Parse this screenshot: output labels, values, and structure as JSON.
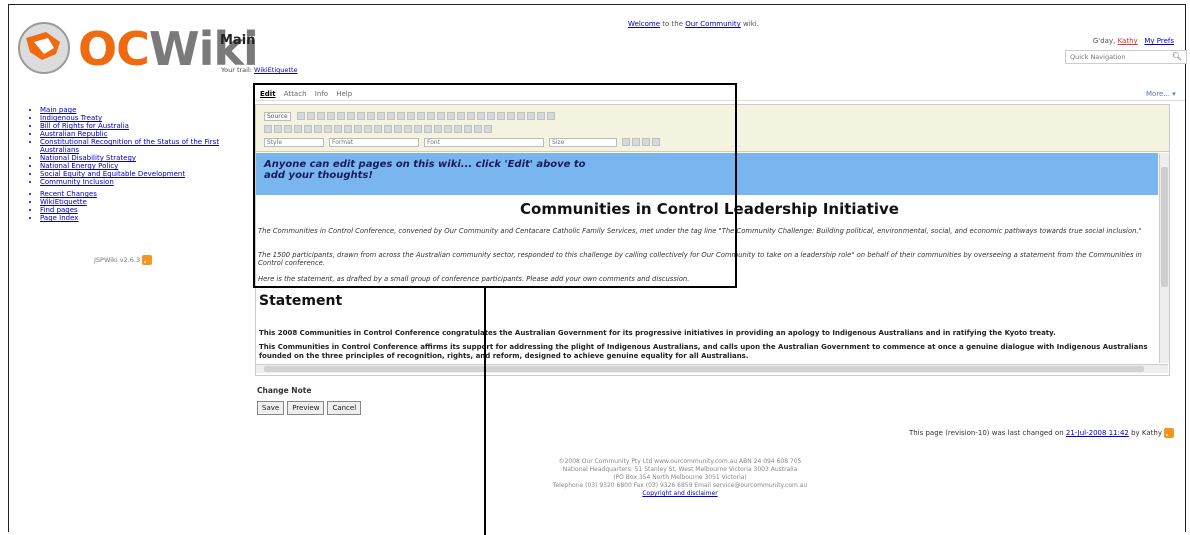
{
  "header": {
    "logo_text_oc": "OC",
    "logo_text_wiki": "Wiki",
    "page_title": "Main",
    "trail_label": "Your trail:",
    "trail_link": "WikiEtiquette",
    "welcome_a": "Welcome",
    "welcome_b": " to the ",
    "welcome_c": "Our Community",
    "welcome_d": " wiki.",
    "gday_a": "G'day, ",
    "gday_user": "Kathy",
    "gday_prefs": "My Prefs",
    "quick_nav_placeholder": "Quick Navigation",
    "more_label": "More... ▾"
  },
  "sidebar": {
    "items_a": [
      "Main page",
      "Indigenous Treaty",
      "Bill of Rights for Australia",
      "Australian Republic",
      "Constitutional Recognition of the Status of the First Australians",
      "National Disability Strategy",
      "National Energy Policy",
      "Social Equity and Equitable Development",
      "Community Inclusion"
    ],
    "items_b": [
      "Recent Changes",
      "WikiEtiquette",
      "Find pages",
      "Page Index"
    ],
    "version": "JSPWiki v2.6.3"
  },
  "tabs": [
    "Edit",
    "Attach",
    "Info",
    "Help"
  ],
  "toolbar": {
    "source_label": "Source",
    "style_label": "Style",
    "format_label": "Format",
    "font_label": "Font",
    "size_label": "Size"
  },
  "editor": {
    "banner_line1": "Anyone can edit pages on this wiki... click 'Edit' above to",
    "banner_line2": "add your thoughts!",
    "heading": "Communities in Control Leadership Initiative",
    "para1": "The Communities in Control Conference, convened by Our Community and Centacare Catholic Family Services,  met under the tag line \"The Community Challenge: Building political, environmental, social, and economic pathways towards true social inclusion.\"",
    "para2": "The 1500 participants, drawn from across the Australian community sector, responded to this challenge by calling collectively for Our Community to take on a leadership role\" on behalf of their communities by overseeing a statement from the Communities in Control conference.",
    "para3": "Here is the statement, as drafted by a small group of conference participants. Please add your own comments and discussion.",
    "statement_heading": "Statement",
    "stmt1": "This 2008 Communities in Control Conference congratulates the Australian Government for its progressive initiatives in providing an apology to Indigenous Australians and in ratifying the Kyoto treaty.",
    "stmt2": "This Communities in Control Conference affirms its support for addressing the plight of Indigenous Australians, and calls upon the Australian Government to commence at once a genuine dialogue with Indigenous Australians founded on the three principles of recognition, rights, and reform, designed to achieve genuine equality for all Australians."
  },
  "form": {
    "change_note_label": "Change Note",
    "save": "Save",
    "preview": "Preview",
    "cancel": "Cancel"
  },
  "status": {
    "last_changed_a": "This page (revision-10) was last changed on ",
    "last_changed_date": "21-Jul-2008 11:42",
    "last_changed_b": " by Kathy"
  },
  "footer": {
    "line1": "©2008 Our Community Pty Ltd   www.ourcommunity.com.au   ABN 24 094 608 705",
    "line2": "National Headquarters: 51 Stanley St, West Melbourne Victoria 3003 Australia",
    "line3": "(PO Box 354 North Melbourne 3051 Victoria)",
    "line4": "Telephone (03) 9320 6800   Fax (03) 9326 6859   Email service@ourcommunity.com.au",
    "line5": "Copyright and disclaimer"
  },
  "colors": {
    "logo_orange": "#f06a10",
    "banner_blue": "#79b6f0",
    "toolbar_bg": "#f4f3df",
    "link": "#0000cc"
  }
}
